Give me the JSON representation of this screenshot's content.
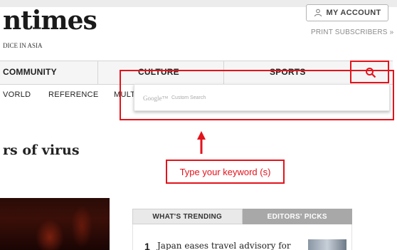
{
  "header": {
    "logo_text": "ntimes",
    "tagline": "DICE IN ASIA",
    "account_label": "MY ACCOUNT",
    "print_link": "PRINT SUBSCRIBERS »"
  },
  "nav": {
    "items": [
      "COMMUNITY",
      "CULTURE",
      "SPORTS"
    ],
    "search_icon": "search-icon"
  },
  "subnav": {
    "items": [
      "VORLD",
      "REFERENCE",
      "MULT"
    ]
  },
  "search": {
    "brand": "Google™",
    "brand_sub": "Custom Search",
    "placeholder": "",
    "value": ""
  },
  "annotation": {
    "callout": "Type your keyword (s)",
    "color": "#e3131b"
  },
  "article": {
    "headline": "rs of virus"
  },
  "sidebar": {
    "tabs": [
      "WHAT'S TRENDING",
      "EDITORS' PICKS"
    ],
    "trending": [
      {
        "number": "1",
        "title": "Japan eases travel advisory for"
      }
    ]
  }
}
